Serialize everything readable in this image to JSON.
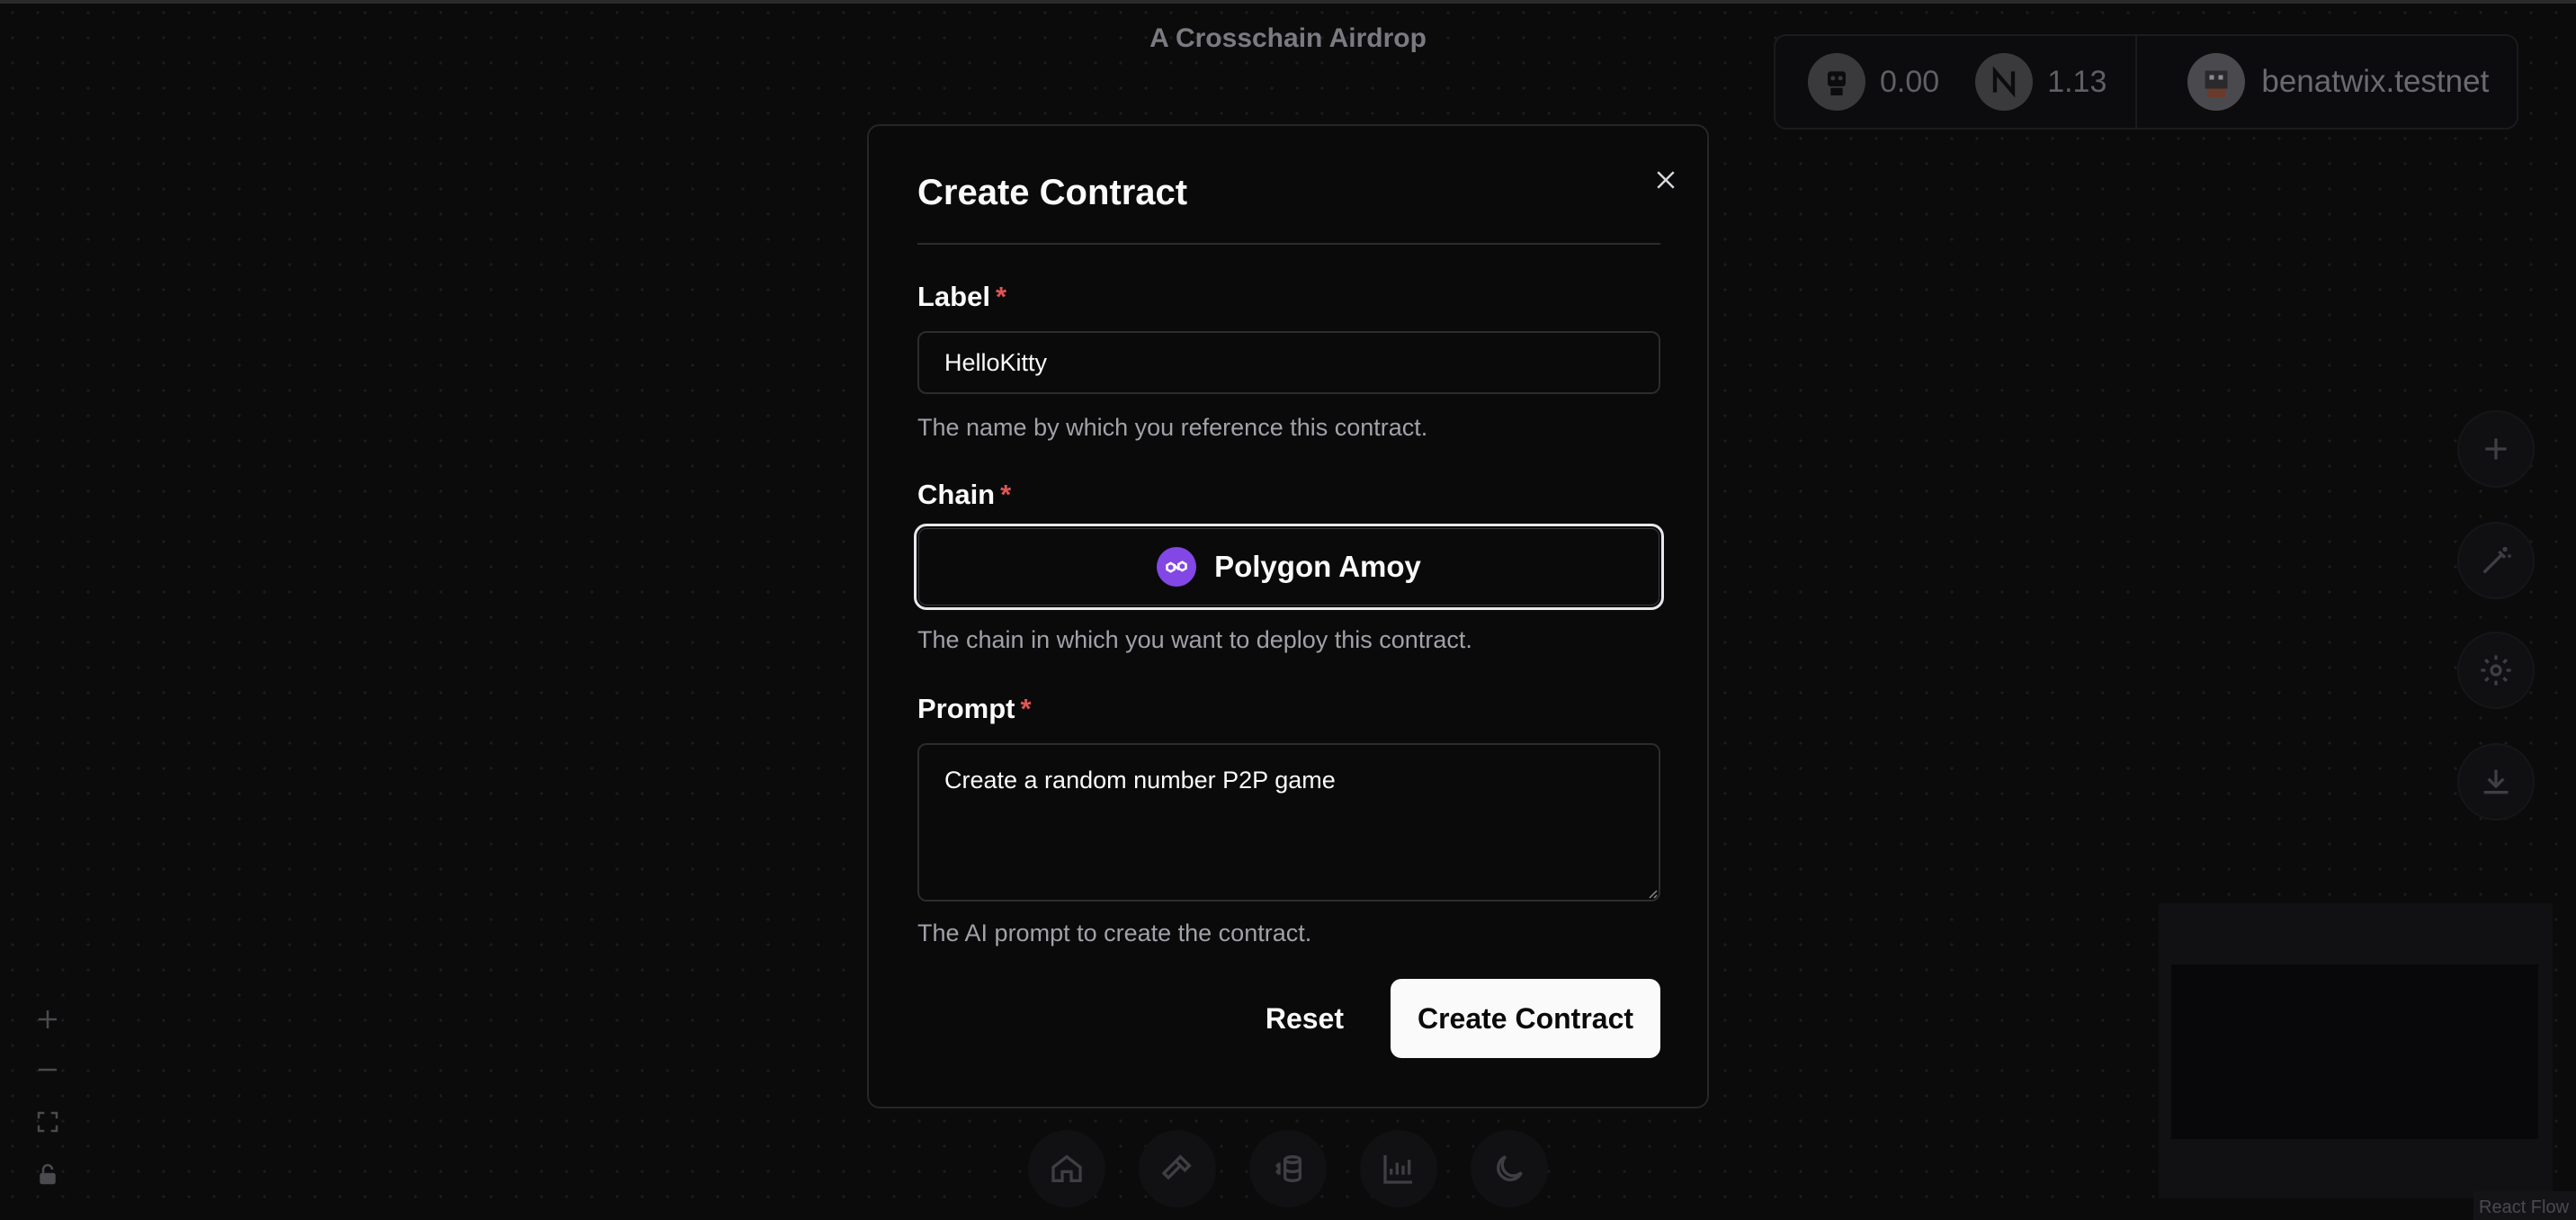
{
  "page": {
    "title": "A Crosschain Airdrop"
  },
  "wallet": {
    "token1_icon": "robot-token-icon",
    "token1_balance": "0.00",
    "token2_icon": "near-logo-icon",
    "token2_balance": "1.13",
    "account_avatar": "pixel-avatar",
    "account_name": "benatwix.testnet"
  },
  "side_tools": [
    "plus-icon",
    "magic-wand-icon",
    "gear-icon",
    "download-icon"
  ],
  "zoom_controls": [
    "zoom-in-icon",
    "zoom-out-icon",
    "fit-view-icon",
    "lock-icon"
  ],
  "dock": [
    "home-icon",
    "hammer-icon",
    "coins-icon",
    "chart-icon",
    "moon-icon"
  ],
  "flow": {
    "attribution": "React Flow"
  },
  "modal": {
    "title": "Create Contract",
    "label_field": {
      "label": "Label",
      "required_mark": "*",
      "value": "HelloKitty",
      "helper": "The name by which you reference this contract."
    },
    "chain_field": {
      "label": "Chain",
      "required_mark": "*",
      "value": "Polygon Amoy",
      "icon": "polygon-logo-icon",
      "icon_color": "#8247e5",
      "helper": "The chain in which you want to deploy this contract."
    },
    "prompt_field": {
      "label": "Prompt",
      "required_mark": "*",
      "value": "Create a random number P2P game",
      "helper": "The AI prompt to create the contract."
    },
    "reset_label": "Reset",
    "submit_label": "Create Contract"
  },
  "colors": {
    "background": "#0b0b0c",
    "modal_background": "#0a0a0b",
    "required": "#e05555",
    "primary_button": "#fafafa"
  }
}
